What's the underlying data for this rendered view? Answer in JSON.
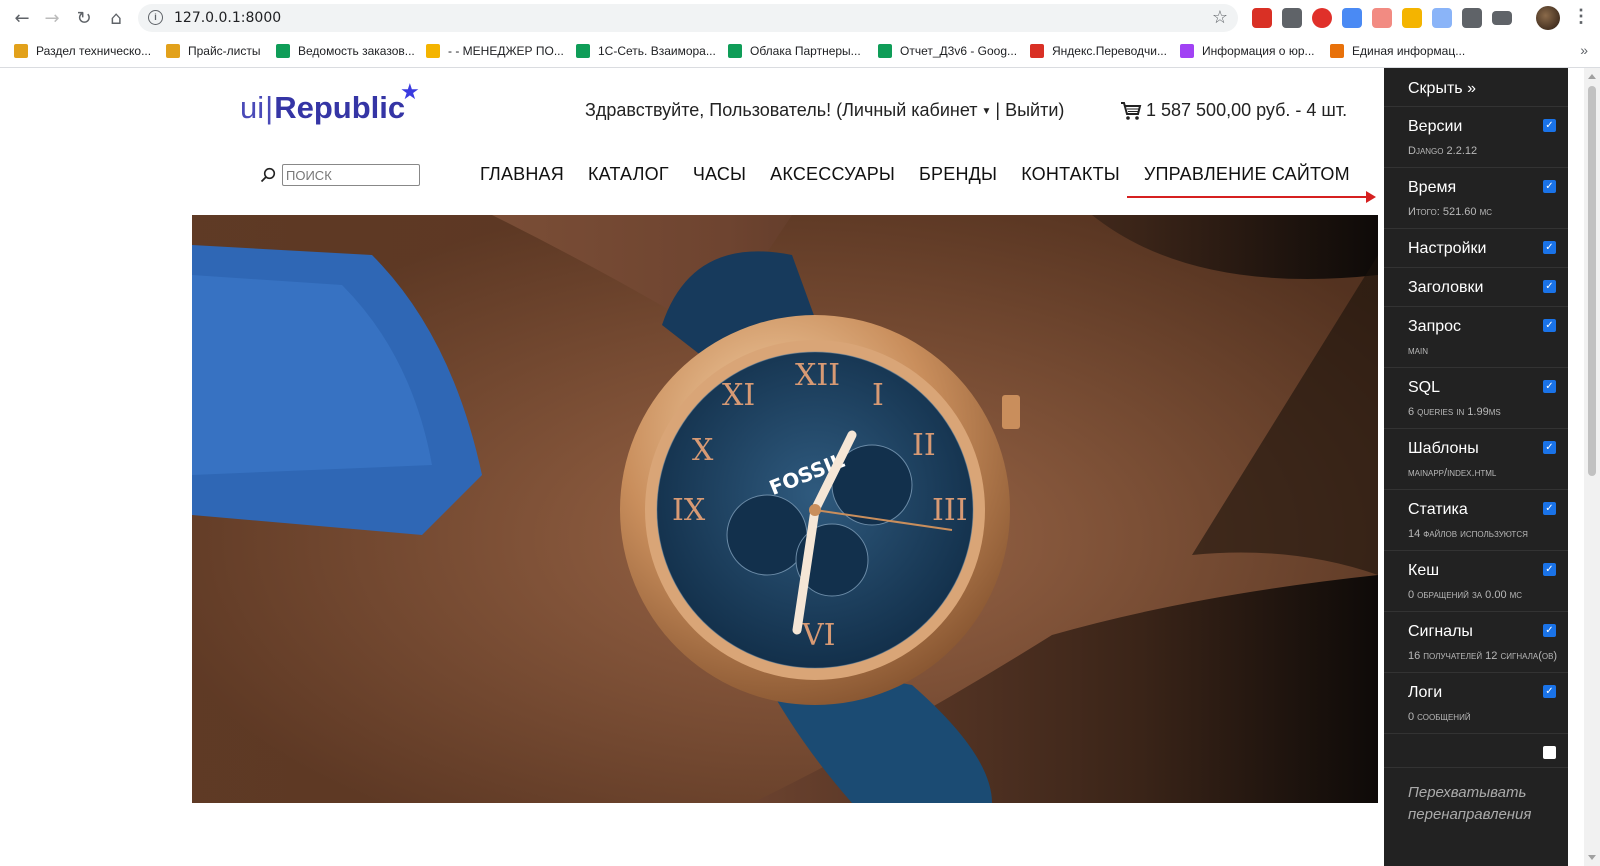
{
  "browser": {
    "url": "127.0.0.1:8000",
    "bookmarks": [
      {
        "label": "Раздел техническо...",
        "color": "#e2a11b"
      },
      {
        "label": "Прайс-листы",
        "color": "#e2a11b"
      },
      {
        "label": "Ведомость заказов...",
        "color": "#0f9d58"
      },
      {
        "label": "- - МЕНЕДЖЕР ПО...",
        "color": "#f4b400"
      },
      {
        "label": "1С-Сеть. Взаимора...",
        "color": "#0f9d58"
      },
      {
        "label": "Облака Партнеры...",
        "color": "#0f9d58"
      },
      {
        "label": "Отчет_Д3v6 - Goog...",
        "color": "#0f9d58"
      },
      {
        "label": "Яндекс.Переводчи...",
        "color": "#d93025"
      },
      {
        "label": "Информация о юр...",
        "color": "#a142f4"
      },
      {
        "label": "Единая информац...",
        "color": "#e8710a"
      }
    ],
    "bookmarks_more": "»"
  },
  "site": {
    "logo_ui": "ui",
    "logo_bar": "|",
    "logo_republic": "Republic",
    "logo_star": "★",
    "greeting_prefix": "Здравствуйте, Пользователь! (Личный кабинет",
    "greeting_caret": "▼",
    "greeting_suffix": "| Выйти)",
    "cart_text": "1 587 500,00 руб. - 4 шт.",
    "search_placeholder": "ПОИСК",
    "nav": [
      "ГЛАВНАЯ",
      "КАТАЛОГ",
      "ЧАСЫ",
      "АКСЕССУАРЫ",
      "БРЕНДЫ",
      "КОНТАКТЫ",
      "УПРАВЛЕНИЕ САЙТОМ"
    ],
    "hero_brand": "FOSSIL"
  },
  "debug_toolbar": {
    "hide_label": "Скрыть »",
    "panels": [
      {
        "title": "Версии",
        "subtitle": "Django 2.2.12",
        "checked": true
      },
      {
        "title": "Время",
        "subtitle": "Итого: 521.60 мс",
        "checked": true
      },
      {
        "title": "Настройки",
        "subtitle": "",
        "checked": true
      },
      {
        "title": "Заголовки",
        "subtitle": "",
        "checked": true
      },
      {
        "title": "Запрос",
        "subtitle": "main",
        "checked": true
      },
      {
        "title": "SQL",
        "subtitle": "6 queries in 1.99ms",
        "checked": true
      },
      {
        "title": "Шаблоны",
        "subtitle": "mainapp/index.html",
        "checked": true
      },
      {
        "title": "Статика",
        "subtitle": "14 файлов используются",
        "checked": true
      },
      {
        "title": "Кеш",
        "subtitle": "0 обращений за 0.00 мс",
        "checked": true
      },
      {
        "title": "Сигналы",
        "subtitle": "16 получателей 12 сигнала(ов)",
        "checked": true
      },
      {
        "title": "Логи",
        "subtitle": "0 сообщений",
        "checked": true
      },
      {
        "title": "",
        "subtitle": "",
        "checked": false
      }
    ],
    "redirect_label": "Перехватывать перенаправления"
  }
}
